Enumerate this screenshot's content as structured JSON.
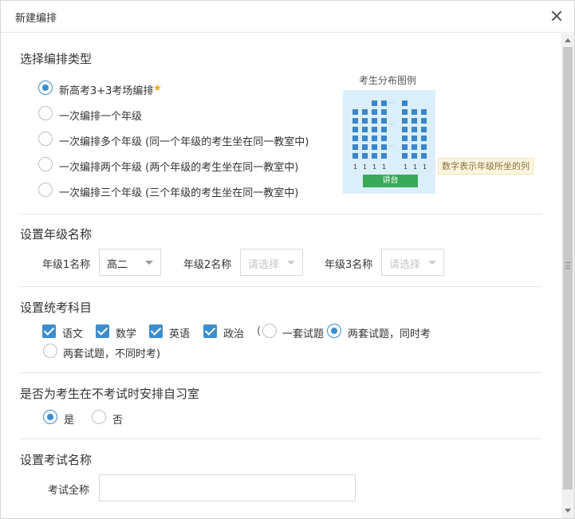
{
  "dialog": {
    "title": "新建编排"
  },
  "type_section": {
    "title": "选择编排类型",
    "options": [
      {
        "label": "新高考3+3考场编排",
        "selected": true,
        "starred": true
      },
      {
        "label": "一次编排一个年级",
        "selected": false
      },
      {
        "label": "一次编排多个年级 (同一个年级的考生坐在同一教室中)",
        "selected": false
      },
      {
        "label": "一次编排两个年级 (两个年级的考生坐在同一教室中)",
        "selected": false
      },
      {
        "label": "一次编排三个年级 (三个年级的考生坐在同一教室中)",
        "selected": false
      }
    ],
    "legend": {
      "title": "考生分布图例",
      "dots": "···",
      "column_numbers": [
        "1",
        "1",
        "1",
        "1",
        "1",
        "1",
        "1"
      ],
      "podium": "讲台",
      "tip": "数字表示年级所坐的列"
    }
  },
  "grade_section": {
    "title": "设置年级名称",
    "grades": [
      {
        "label": "年级1名称",
        "value": "高二",
        "placeholder": false
      },
      {
        "label": "年级2名称",
        "value": "请选择",
        "placeholder": true
      },
      {
        "label": "年级3名称",
        "value": "请选择",
        "placeholder": true
      }
    ]
  },
  "subject_section": {
    "title": "设置统考科目",
    "subjects": [
      "语文",
      "数学",
      "英语",
      "政治"
    ],
    "open_paren": "(",
    "modes": [
      {
        "label": "一套试题",
        "selected": false
      },
      {
        "label": "两套试题，同时考",
        "selected": true
      },
      {
        "label": "两套试题，不同时考)",
        "selected": false
      }
    ]
  },
  "study_section": {
    "title": "是否为考生在不考试时安排自习室",
    "options": [
      {
        "label": "是",
        "selected": true
      },
      {
        "label": "否",
        "selected": false
      }
    ]
  },
  "exam_section": {
    "title": "设置考试名称",
    "name_label": "考试全称",
    "name_value": ""
  },
  "colors": {
    "accent": "#3c8dcd",
    "podium": "#3aaa5a",
    "legend_bg": "#dbeffb",
    "star": "#f5a623"
  }
}
